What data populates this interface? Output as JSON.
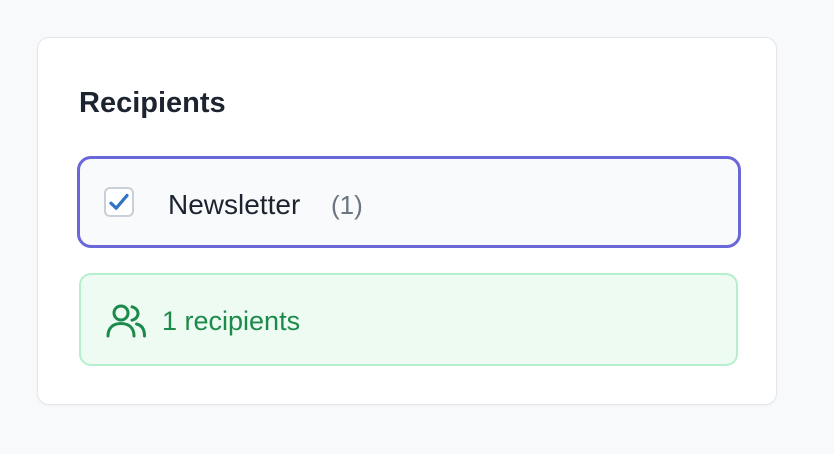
{
  "recipients": {
    "title": "Recipients",
    "options": [
      {
        "label": "Newsletter",
        "count": "(1)",
        "checked": true
      }
    ],
    "summary": {
      "icon": "users-icon",
      "text": "1 recipients"
    }
  },
  "colors": {
    "accent_border": "#6a67d8",
    "checkbox_check": "#2f73c7",
    "summary_background": "#edfbf2",
    "summary_border": "#b6efcd",
    "summary_text": "#1c8a4a"
  }
}
